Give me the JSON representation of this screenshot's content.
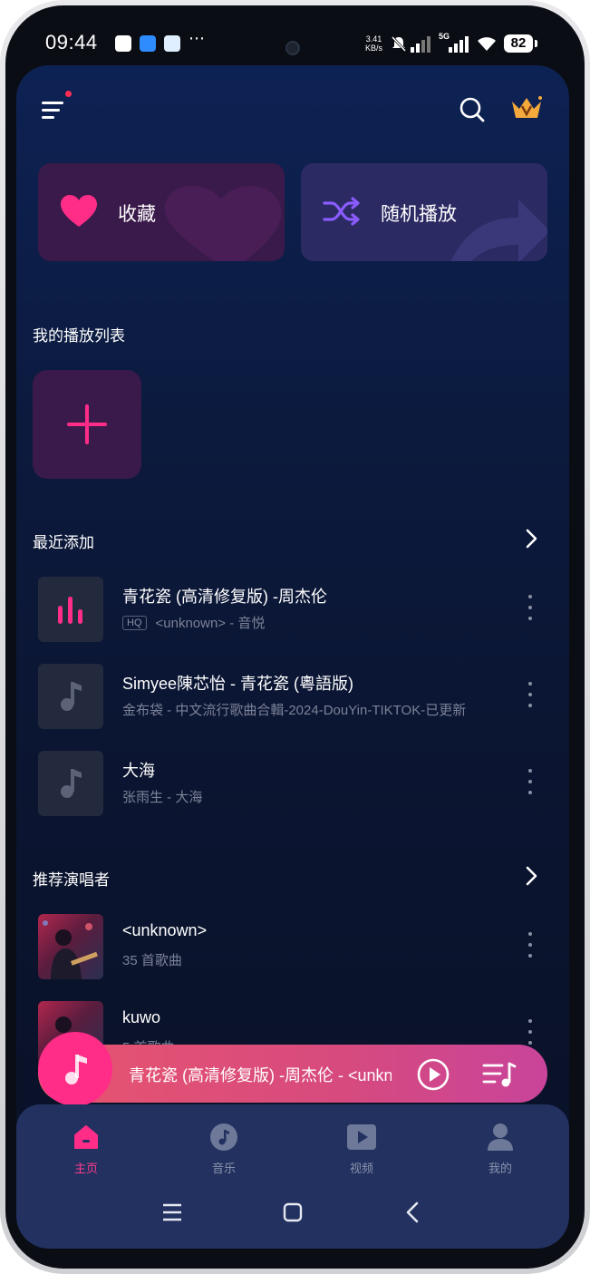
{
  "status_bar": {
    "time": "09:44",
    "net_speed_value": "3.41",
    "net_speed_unit": "KB/s",
    "network_type": "5G",
    "battery": "82",
    "icons": [
      "qq-icon",
      "app-store-icon",
      "cloud-icon",
      "more-icon",
      "silent-icon",
      "signal-icon",
      "signal-5g-icon",
      "wifi-icon"
    ]
  },
  "header": {
    "menu_icon": "menu-icon",
    "search_icon": "search-icon",
    "vip_icon": "crown-icon"
  },
  "quick_actions": [
    {
      "label": "收藏",
      "icon": "heart-icon",
      "color": "#ff2d87"
    },
    {
      "label": "随机播放",
      "icon": "shuffle-icon",
      "color": "#8a5cff"
    }
  ],
  "playlists": {
    "title": "我的播放列表",
    "add_icon": "plus-icon"
  },
  "recent": {
    "title": "最近添加",
    "items": [
      {
        "title": "青花瓷 (高清修复版) -周杰伦",
        "badge": "HQ",
        "subtitle": "<unknown> - 音悦",
        "thumb": "equalizer-icon"
      },
      {
        "title": "Simyee陳芯怡 - 青花瓷 (粵語版)",
        "subtitle": "金布袋 - 中文流行歌曲合輯-2024-DouYin-TIKTOK-已更新",
        "thumb": "music-note-icon"
      },
      {
        "title": "大海",
        "subtitle": "张雨生 - 大海",
        "thumb": "music-note-icon"
      }
    ]
  },
  "artists": {
    "title": "推荐演唱者",
    "items": [
      {
        "name": "<unknown>",
        "count": "35 首歌曲"
      },
      {
        "name": "kuwo",
        "count": "5 首歌曲"
      }
    ]
  },
  "mini_player": {
    "title": "青花瓷 (高清修复版) -周杰伦 - <unknown>",
    "play_icon": "play-circle-icon",
    "queue_icon": "playlist-icon"
  },
  "bottom_nav": [
    {
      "label": "主页",
      "icon": "home-icon",
      "active": true
    },
    {
      "label": "音乐",
      "icon": "music-disc-icon",
      "active": false
    },
    {
      "label": "视频",
      "icon": "video-icon",
      "active": false
    },
    {
      "label": "我的",
      "icon": "user-icon",
      "active": false
    }
  ],
  "colors": {
    "accent": "#ff2d87",
    "background_top": "#0d2254",
    "background_bottom": "#0a1126",
    "nav_bg": "#22315f"
  }
}
